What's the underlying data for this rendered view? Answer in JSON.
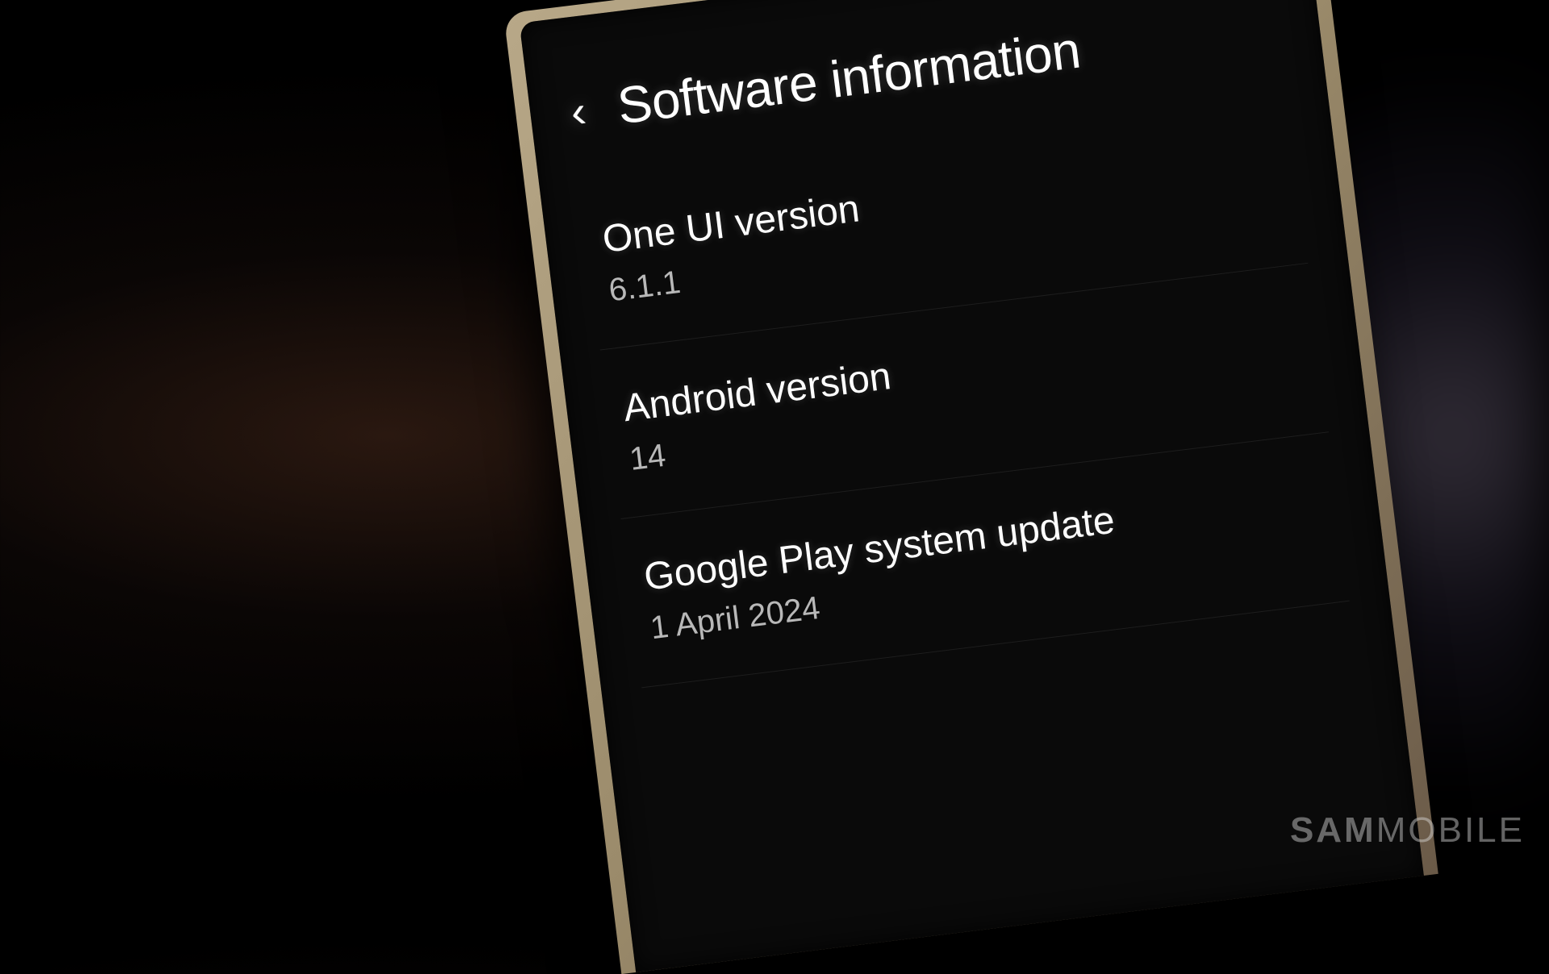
{
  "header": {
    "title": "Software information"
  },
  "settings": [
    {
      "label": "One UI version",
      "value": "6.1.1"
    },
    {
      "label": "Android version",
      "value": "14"
    },
    {
      "label": "Google Play system update",
      "value": "1 April 2024"
    }
  ],
  "watermark": {
    "bold": "SAM",
    "light": "MOBILE"
  }
}
